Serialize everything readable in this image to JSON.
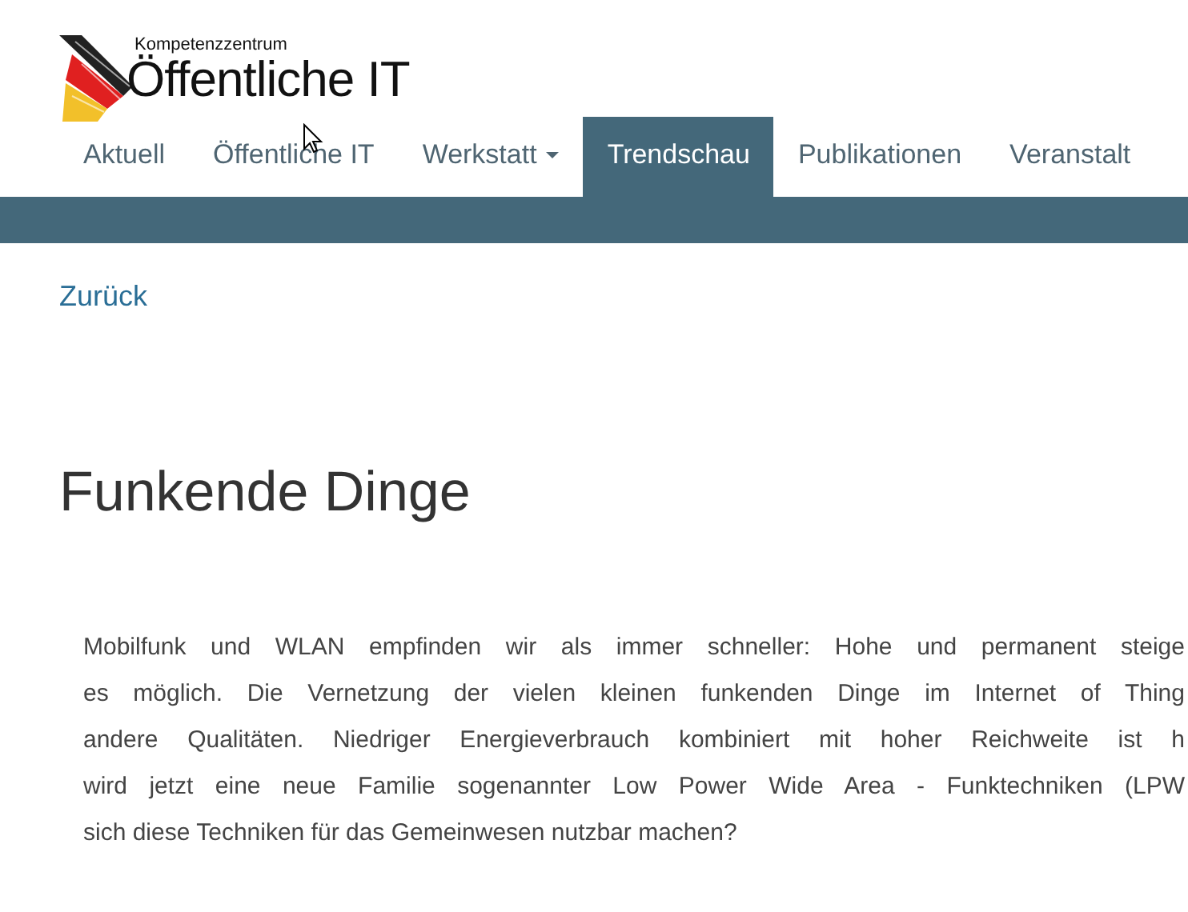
{
  "logo": {
    "kicker": "Kompetenzzentrum",
    "name": "Öffentliche IT"
  },
  "nav": [
    {
      "label": "Aktuell",
      "selected": false,
      "dropdown": false
    },
    {
      "label": "Öffentliche IT",
      "selected": false,
      "dropdown": false
    },
    {
      "label": "Werkstatt",
      "selected": false,
      "dropdown": true
    },
    {
      "label": "Trendschau",
      "selected": true,
      "dropdown": false
    },
    {
      "label": "Publikationen",
      "selected": false,
      "dropdown": false
    },
    {
      "label": "Veranstalt",
      "selected": false,
      "dropdown": false
    }
  ],
  "back_link": "Zurück",
  "heading": "Funkende Dinge",
  "paragraph_lines": [
    "Mobilfunk und WLAN empfinden wir als immer schneller: Hohe und permanent steige",
    "es möglich. Die Vernetzung der vielen kleinen funkenden Dinge im Internet of Thing",
    "andere Qualitäten. Niedriger Energieverbrauch kombiniert mit hoher Reichweite ist h",
    "wird jetzt eine neue Familie sogenannter Low Power Wide Area - Funktechniken (LPW",
    "sich diese Techniken für das Gemeinwesen nutzbar machen?"
  ]
}
